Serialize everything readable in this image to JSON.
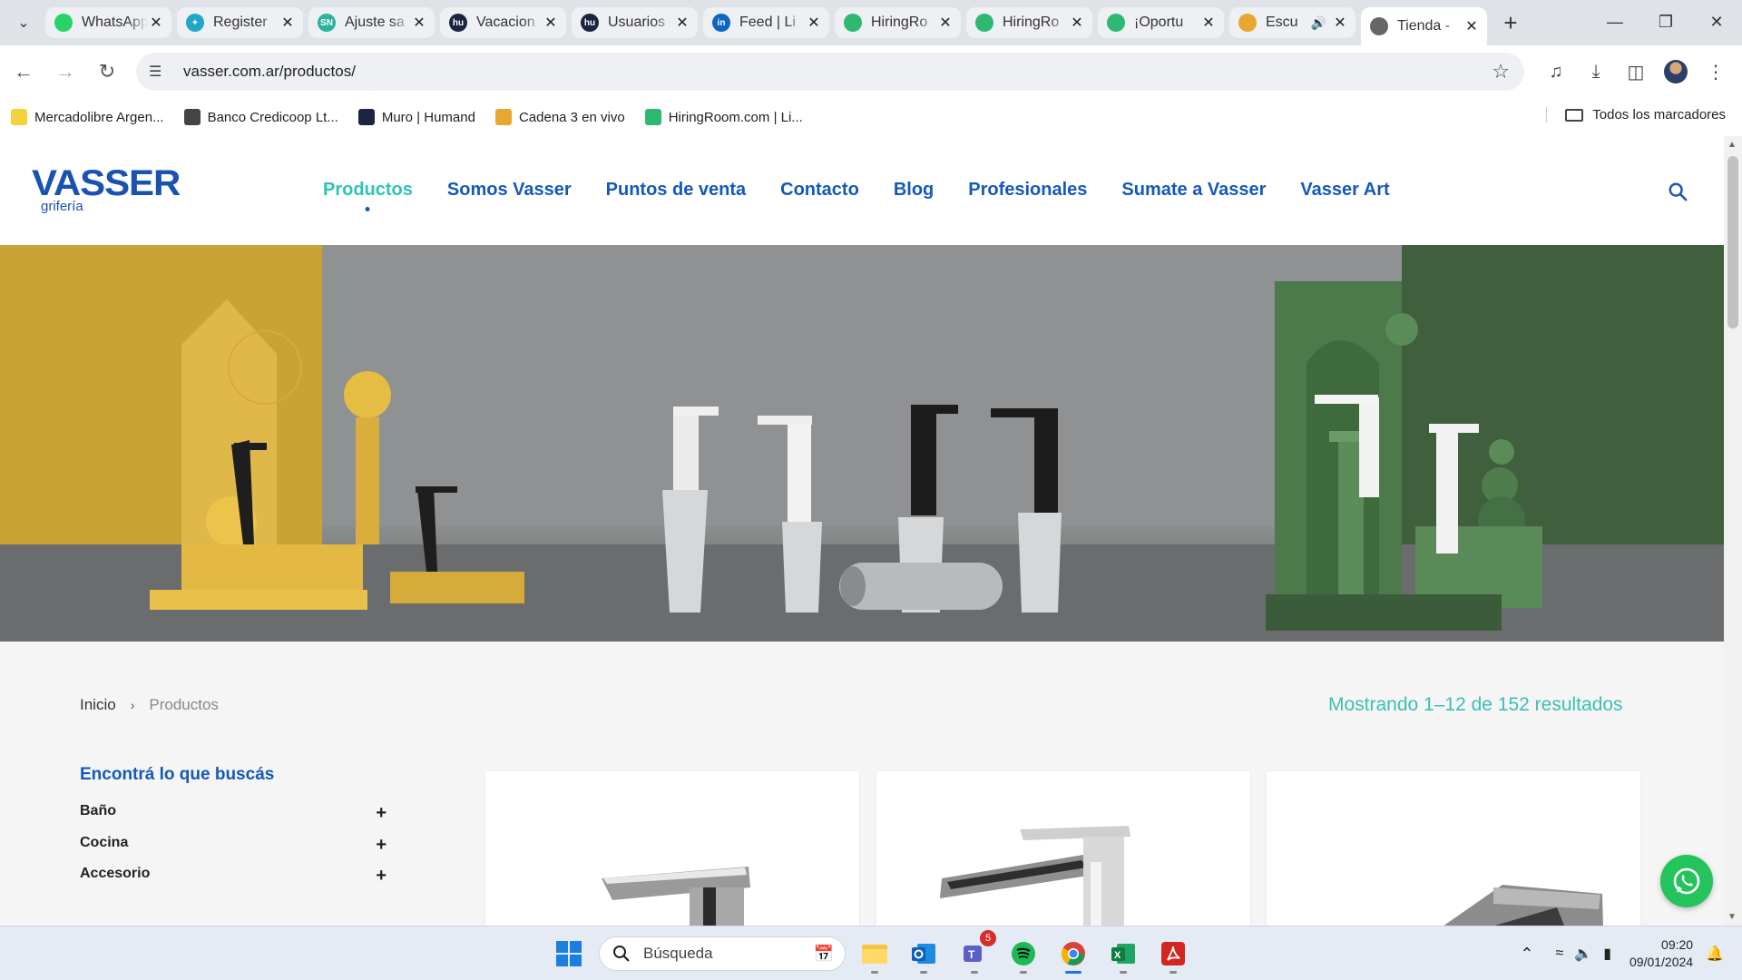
{
  "browser": {
    "tabs": [
      {
        "title": "WhatsApp",
        "favicon": "whatsapp-icon",
        "color": "#25d366",
        "glyph": ""
      },
      {
        "title": "Register",
        "favicon": "register-icon",
        "color": "#1fa7c9",
        "glyph": "✦"
      },
      {
        "title": "Ajuste sa",
        "favicon": "ajuste-icon",
        "color": "#2bb3a0",
        "glyph": "SN"
      },
      {
        "title": "Vacacion",
        "favicon": "humand-icon",
        "color": "#1b2540",
        "glyph": "hu"
      },
      {
        "title": "Usuarios",
        "favicon": "humand-icon",
        "color": "#1b2540",
        "glyph": "hu"
      },
      {
        "title": "Feed | Li",
        "favicon": "linkedin-icon",
        "color": "#0a66c2",
        "glyph": "in"
      },
      {
        "title": "HiringRo",
        "favicon": "hiringroom-icon",
        "color": "#2eb872",
        "glyph": ""
      },
      {
        "title": "HiringRo",
        "favicon": "hiringroom-icon",
        "color": "#2eb872",
        "glyph": ""
      },
      {
        "title": "¡Oportu",
        "favicon": "hiringroom-icon",
        "color": "#2eb872",
        "glyph": ""
      },
      {
        "title": "Escu",
        "favicon": "cadena3-icon",
        "color": "#e8a732",
        "glyph": "",
        "audio": true
      },
      {
        "title": "Tienda -",
        "favicon": "globe-icon",
        "color": "#666666",
        "glyph": "",
        "active": true
      }
    ],
    "url": "vasser.com.ar/productos/",
    "bookmarks": [
      {
        "label": "Mercadolibre Argen...",
        "icon": "mercadolibre-icon",
        "color": "#f2d33b"
      },
      {
        "label": "Banco Credicoop Lt...",
        "icon": "credicoop-icon",
        "color": "#444444"
      },
      {
        "label": "Muro | Humand",
        "icon": "humand-icon",
        "color": "#1b2540"
      },
      {
        "label": "Cadena 3 en vivo",
        "icon": "cadena3-icon",
        "color": "#e8a732"
      },
      {
        "label": "HiringRoom.com | Li...",
        "icon": "hiringroom-icon",
        "color": "#2eb872"
      }
    ],
    "all_bookmarks_label": "Todos los marcadores"
  },
  "site": {
    "logo_main": "VASSER",
    "logo_sub": "grifería",
    "nav": [
      "Productos",
      "Somos Vasser",
      "Puntos de venta",
      "Contacto",
      "Blog",
      "Profesionales",
      "Sumate a Vasser",
      "Vasser Art"
    ],
    "active_nav": "Productos",
    "breadcrumb": {
      "home": "Inicio",
      "separator": "›",
      "current": "Productos"
    },
    "result_count": "Mostrando 1–12 de 152 resultados",
    "filter_title": "Encontrá lo que buscás",
    "filters": [
      {
        "label": "Baño",
        "toggle": "+"
      },
      {
        "label": "Cocina",
        "toggle": "+"
      },
      {
        "label": "Accesorio",
        "toggle": "+"
      }
    ],
    "brand_color": "#1559b8",
    "accent_color": "#2ec4b6"
  },
  "taskbar": {
    "search_placeholder": "Búsqueda",
    "teams_badge": "5",
    "time": "09:20",
    "date": "09/01/2024"
  }
}
